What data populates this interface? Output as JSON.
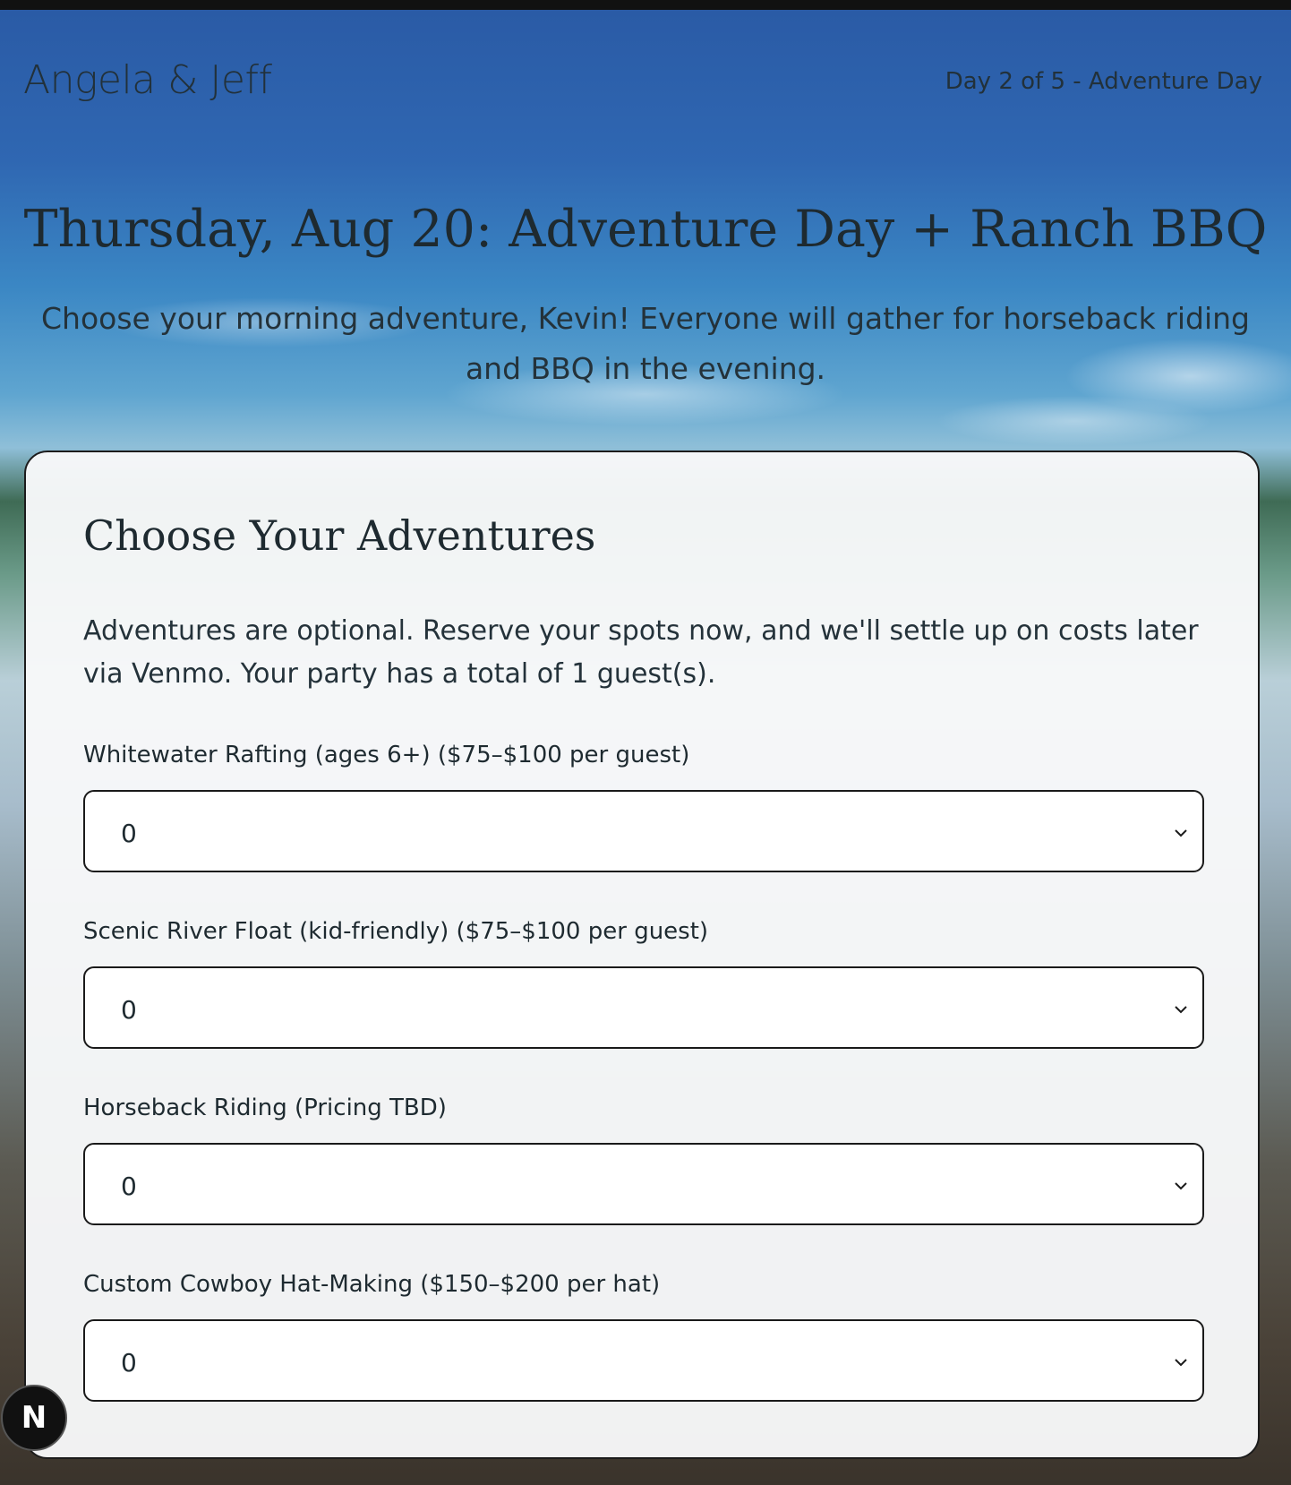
{
  "header": {
    "brand": "Angela & Jeff",
    "day_label": "Day 2 of 5 - Adventure Day"
  },
  "hero": {
    "title": "Thursday, Aug 20: Adventure Day + Ranch BBQ",
    "subtitle": "Choose your morning adventure, Kevin! Everyone will gather for horseback riding and BBQ in the evening."
  },
  "card": {
    "title": "Choose Your Adventures",
    "intro": "Adventures are optional. Reserve your spots now, and we'll settle up on costs later via Venmo. Your party has a total of 1 guest(s).",
    "fields": [
      {
        "label": "Whitewater Rafting (ages 6+) ($75–$100 per guest)",
        "value": "0"
      },
      {
        "label": "Scenic River Float (kid-friendly) ($75–$100 per guest)",
        "value": "0"
      },
      {
        "label": "Horseback Riding (Pricing TBD)",
        "value": "0"
      },
      {
        "label": "Custom Cowboy Hat-Making ($150–$200 per hat)",
        "value": "0"
      }
    ]
  },
  "badge": {
    "letter": "N"
  },
  "icons": {
    "dropdown": "chevron-down-icon"
  },
  "colors": {
    "sky_top": "#2a5aa5",
    "text_dark": "#1e2a30",
    "card_bg": "#f7f8f9",
    "border": "#1a1a1a"
  }
}
